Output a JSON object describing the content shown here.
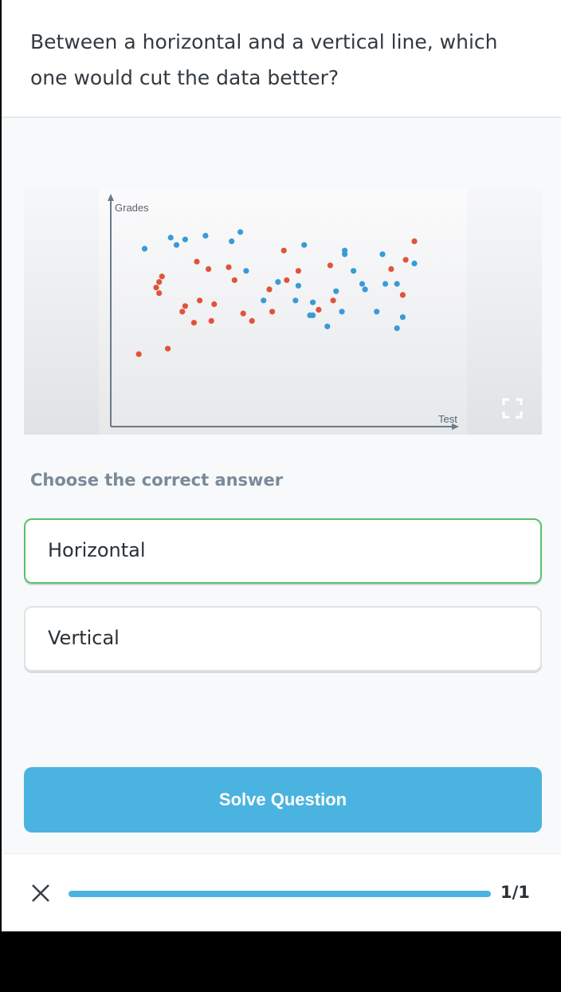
{
  "question": {
    "text": "Between a horizontal and a vertical line, which one would cut the data better?"
  },
  "figure": {
    "expand_icon": "expand-icon",
    "chart_data": {
      "type": "scatter",
      "xlabel": "Test",
      "ylabel": "Grades",
      "series": [
        {
          "color": "#e0533a",
          "points": [
            [
              0.24,
              0.51
            ],
            [
              0.41,
              0.56
            ],
            [
              0.67,
              0.58
            ],
            [
              0.51,
              0.57
            ],
            [
              0.31,
              0.61
            ],
            [
              0.26,
              0.63
            ],
            [
              0.72,
              0.63
            ],
            [
              0.96,
              0.66
            ],
            [
              0.56,
              0.74
            ],
            [
              0.38,
              0.74
            ],
            [
              0.6,
              0.79
            ],
            [
              0.92,
              0.8
            ],
            [
              0.71,
              0.82
            ],
            [
              0.97,
              0.85
            ],
            [
              1.0,
              0.95
            ],
            [
              0.05,
              0.34
            ],
            [
              0.15,
              0.37
            ],
            [
              0.3,
              0.52
            ],
            [
              0.44,
              0.52
            ],
            [
              0.2,
              0.57
            ],
            [
              0.12,
              0.67
            ],
            [
              0.5,
              0.69
            ],
            [
              0.21,
              0.6
            ],
            [
              0.55,
              0.9
            ],
            [
              0.11,
              0.7
            ],
            [
              0.12,
              0.73
            ],
            [
              0.13,
              0.76
            ],
            [
              0.29,
              0.8
            ],
            [
              0.36,
              0.81
            ],
            [
              0.25,
              0.84
            ]
          ]
        },
        {
          "color": "#3a9ad6",
          "points": [
            [
              0.07,
              0.91
            ],
            [
              0.18,
              0.93
            ],
            [
              0.21,
              0.96
            ],
            [
              0.16,
              0.97
            ],
            [
              0.28,
              0.98
            ],
            [
              0.4,
              1.0
            ],
            [
              0.62,
              0.93
            ],
            [
              0.76,
              0.9
            ],
            [
              0.89,
              0.88
            ],
            [
              1.0,
              0.83
            ],
            [
              0.79,
              0.79
            ],
            [
              0.73,
              0.68
            ],
            [
              0.59,
              0.63
            ],
            [
              0.65,
              0.62
            ],
            [
              0.83,
              0.69
            ],
            [
              0.9,
              0.72
            ],
            [
              0.94,
              0.72
            ],
            [
              0.96,
              0.54
            ],
            [
              0.75,
              0.57
            ],
            [
              0.82,
              0.72
            ],
            [
              0.94,
              0.48
            ],
            [
              0.87,
              0.57
            ],
            [
              0.53,
              0.73
            ],
            [
              0.7,
              0.49
            ],
            [
              0.76,
              0.88
            ],
            [
              0.6,
              0.71
            ],
            [
              0.65,
              0.55
            ],
            [
              0.64,
              0.55
            ],
            [
              0.48,
              0.63
            ],
            [
              0.42,
              0.79
            ],
            [
              0.37,
              0.95
            ]
          ]
        }
      ]
    }
  },
  "answers": {
    "prompt": "Choose the correct answer",
    "options": [
      {
        "label": "Horizontal",
        "selected": true
      },
      {
        "label": "Vertical",
        "selected": false
      }
    ]
  },
  "actions": {
    "solve_label": "Solve Question"
  },
  "footer": {
    "close_icon": "close-icon",
    "progress_text": "1/1",
    "progress_fraction": 1.0
  },
  "colors": {
    "accent": "#4bb3e0",
    "selected_border": "#5cbf6b",
    "red_dots": "#e0533a",
    "blue_dots": "#3a9ad6"
  }
}
